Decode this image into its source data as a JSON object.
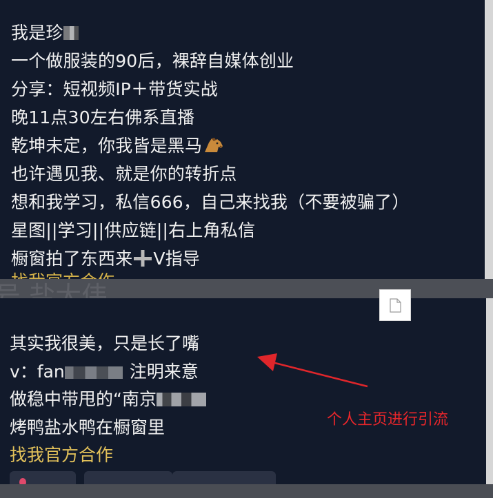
{
  "profile_bio": {
    "lines": [
      "我是珍",
      "一个做服装的90后，裸辞自媒体创业",
      "分享：短视频IP＋带货实战",
      "晚11点30左右佛系直播",
      "乾坤未定，你我皆是黑马",
      "也许遇见我、就是你的转折点",
      "想和我学习，私信666，自己来找我（不要被骗了）",
      "星图||学习||供应链||右上角私信",
      "橱窗拍了东西来",
      "V指导"
    ],
    "cutoff_line": "找我官方合作"
  },
  "watermark": {
    "text": "号   盐大伟"
  },
  "second_profile": {
    "line1": "其实我很美，只是长了嘴",
    "line2_prefix": "v：fan",
    "line2_suffix": "注明来意",
    "line3": "做稳中带甩的“南京",
    "line4": "烤鸭盐水鸭在橱窗里",
    "line5": "找我官方合作",
    "chips": [
      "",
      "",
      ""
    ]
  },
  "annotation": {
    "text": "个人主页进行引流",
    "color": "#e8262b"
  },
  "icons": {
    "horse": "horse-emoji-icon",
    "plus": "heavy-plus-icon",
    "file": "file-icon",
    "location": "location-pin-icon"
  },
  "colors": {
    "background": "#121a2b",
    "text": "#f0f0f0",
    "gold": "#e2c15a"
  }
}
